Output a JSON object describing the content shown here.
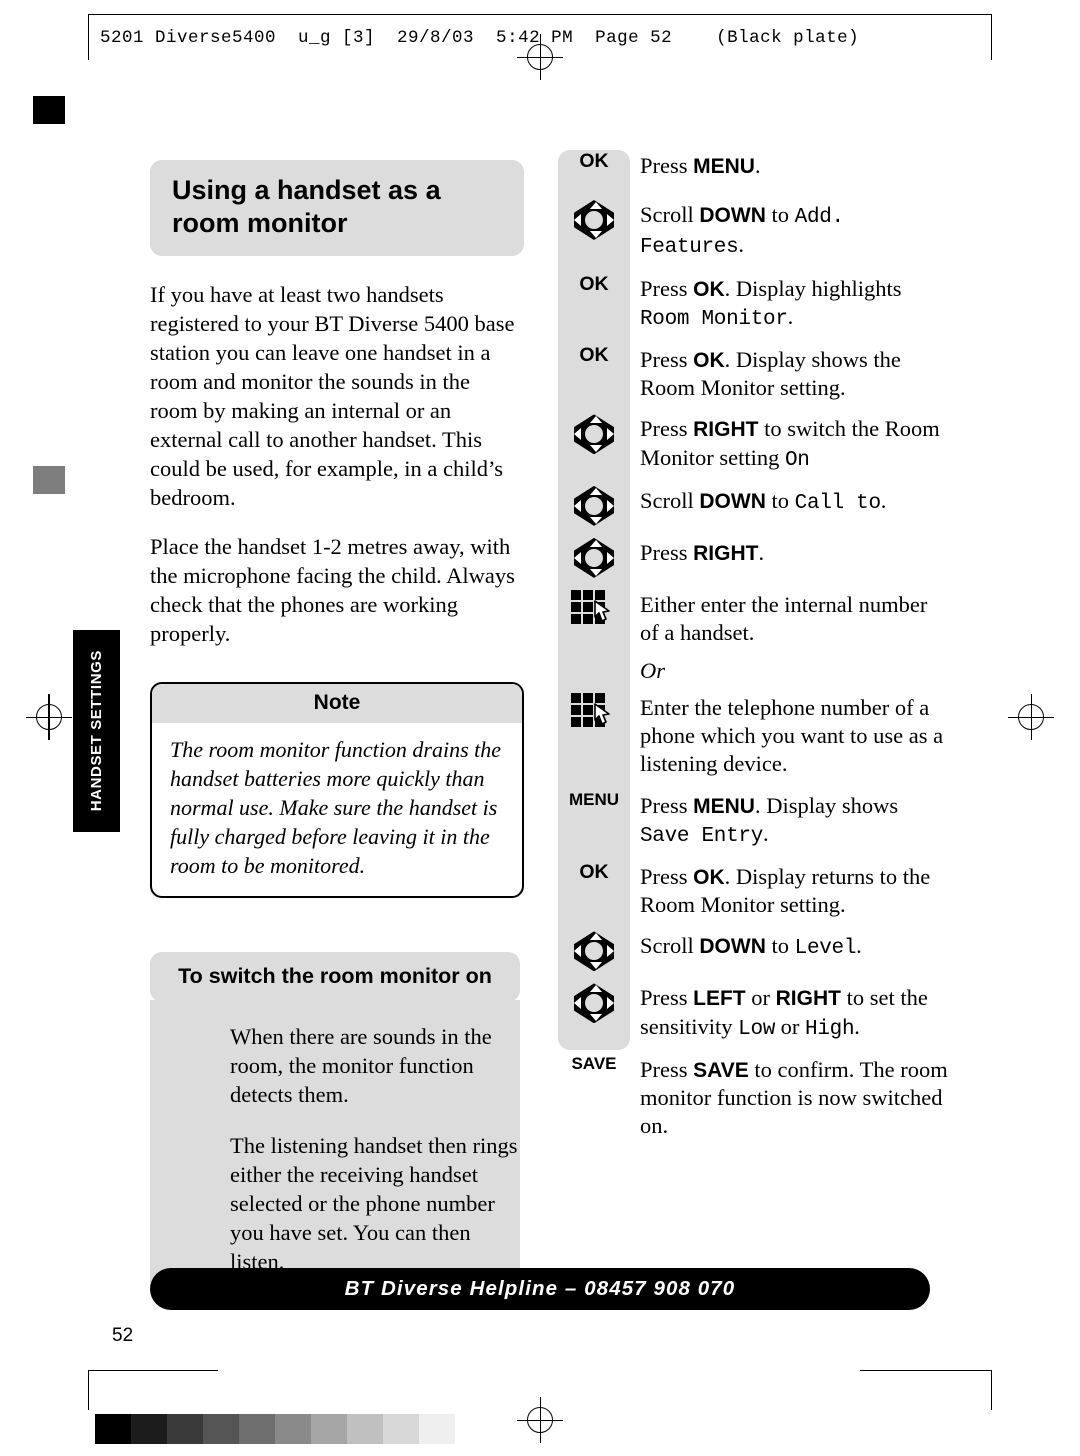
{
  "print_header": "5201 Diverse5400  u_g [3]  29/8/03  5:42 PM  Page 52    (Black plate)",
  "side_tab": "HANDSET SETTINGS",
  "left_column": {
    "title": "Using a handset as a room monitor",
    "paragraphs": [
      "If you have at least two handsets registered to your BT Diverse 5400 base station you can leave one handset in a room and monitor the sounds in the room by making an internal or an external call to another handset. This could be used, for example, in a child’s bedroom.",
      "Place the handset 1-2 metres away, with the microphone facing the child. Always check that the phones are working properly."
    ],
    "note": {
      "heading": "Note",
      "text": "The room monitor function drains the handset batteries more quickly than normal use. Make sure the handset is fully charged before leaving it in the room to be monitored."
    },
    "subsection": {
      "heading": "To switch the room monitor on",
      "paragraphs": [
        "When there are sounds in the room, the monitor function detects them.",
        "The listening handset then rings either the receiving handset selected or the phone number you have set. You can then listen."
      ]
    }
  },
  "steps": [
    {
      "key_type": "label",
      "key": "OK",
      "segments": [
        {
          "t": "Press ",
          "s": "plain"
        },
        {
          "t": "MENU",
          "s": "bold"
        },
        {
          "t": ".",
          "s": "plain"
        }
      ]
    },
    {
      "key_type": "navpad-down",
      "key": "",
      "segments": [
        {
          "t": "Scroll ",
          "s": "plain"
        },
        {
          "t": "DOWN",
          "s": "bold"
        },
        {
          "t": " to ",
          "s": "plain"
        },
        {
          "t": "Add. Features",
          "s": "lcd"
        },
        {
          "t": ".",
          "s": "plain"
        }
      ]
    },
    {
      "key_type": "label",
      "key": "OK",
      "segments": [
        {
          "t": "Press ",
          "s": "plain"
        },
        {
          "t": "OK",
          "s": "bold"
        },
        {
          "t": ". Display highlights ",
          "s": "plain"
        },
        {
          "t": "Room Monitor",
          "s": "lcd"
        },
        {
          "t": ".",
          "s": "plain"
        }
      ]
    },
    {
      "key_type": "label",
      "key": "OK",
      "segments": [
        {
          "t": "Press ",
          "s": "plain"
        },
        {
          "t": "OK",
          "s": "bold"
        },
        {
          "t": ". Display shows the Room Monitor setting.",
          "s": "plain"
        }
      ]
    },
    {
      "key_type": "navpad-right",
      "key": "",
      "segments": [
        {
          "t": "Press ",
          "s": "plain"
        },
        {
          "t": "RIGHT",
          "s": "bold"
        },
        {
          "t": " to switch the Room Monitor setting ",
          "s": "plain"
        },
        {
          "t": "On",
          "s": "lcd"
        }
      ]
    },
    {
      "key_type": "navpad-down",
      "key": "",
      "segments": [
        {
          "t": "Scroll ",
          "s": "plain"
        },
        {
          "t": "DOWN",
          "s": "bold"
        },
        {
          "t": " to ",
          "s": "plain"
        },
        {
          "t": "Call to",
          "s": "lcd"
        },
        {
          "t": ".",
          "s": "plain"
        }
      ]
    },
    {
      "key_type": "navpad-right",
      "key": "",
      "segments": [
        {
          "t": "Press ",
          "s": "plain"
        },
        {
          "t": "RIGHT",
          "s": "bold"
        },
        {
          "t": ".",
          "s": "plain"
        }
      ]
    },
    {
      "key_type": "keypad",
      "key": "",
      "segments": [
        {
          "t": "Either enter the internal number of a handset.",
          "s": "plain"
        }
      ]
    },
    {
      "key_type": "or",
      "key": "",
      "segments": [
        {
          "t": "Or",
          "s": "italic"
        }
      ]
    },
    {
      "key_type": "keypad",
      "key": "",
      "segments": [
        {
          "t": "Enter the telephone number of a phone which you want to use as a listening device.",
          "s": "plain"
        }
      ]
    },
    {
      "key_type": "label",
      "key": "MENU",
      "segments": [
        {
          "t": "Press ",
          "s": "plain"
        },
        {
          "t": "MENU",
          "s": "bold"
        },
        {
          "t": ". Display shows ",
          "s": "plain"
        },
        {
          "t": "Save Entry",
          "s": "lcd"
        },
        {
          "t": ".",
          "s": "plain"
        }
      ]
    },
    {
      "key_type": "label",
      "key": "OK",
      "segments": [
        {
          "t": "Press ",
          "s": "plain"
        },
        {
          "t": "OK",
          "s": "bold"
        },
        {
          "t": ". Display returns to the Room Monitor setting.",
          "s": "plain"
        }
      ]
    },
    {
      "key_type": "navpad-down",
      "key": "",
      "segments": [
        {
          "t": "Scroll ",
          "s": "plain"
        },
        {
          "t": "DOWN",
          "s": "bold"
        },
        {
          "t": " to ",
          "s": "plain"
        },
        {
          "t": "Level",
          "s": "lcd"
        },
        {
          "t": ".",
          "s": "plain"
        }
      ]
    },
    {
      "key_type": "navpad-lr",
      "key": "",
      "segments": [
        {
          "t": "Press ",
          "s": "plain"
        },
        {
          "t": "LEFT",
          "s": "bold"
        },
        {
          "t": " or ",
          "s": "plain"
        },
        {
          "t": "RIGHT",
          "s": "bold"
        },
        {
          "t": " to set the sensitivity ",
          "s": "plain"
        },
        {
          "t": "Low",
          "s": "lcd"
        },
        {
          "t": " or ",
          "s": "plain"
        },
        {
          "t": "High",
          "s": "lcd"
        },
        {
          "t": ".",
          "s": "plain"
        }
      ]
    },
    {
      "key_type": "label",
      "key": "SAVE",
      "segments": [
        {
          "t": "Press ",
          "s": "plain"
        },
        {
          "t": "SAVE",
          "s": "bold"
        },
        {
          "t": " to confirm. The room monitor function is now switched on.",
          "s": "plain"
        }
      ]
    }
  ],
  "footer": {
    "helpline": "BT Diverse Helpline – 08457 908 070",
    "page_number": "52"
  },
  "grayscale": [
    "#000000",
    "#1c1c1c",
    "#3a3a3a",
    "#555555",
    "#6e6e6e",
    "#8a8a8a",
    "#a5a5a5",
    "#c0c0c0",
    "#d8d8d8",
    "#efefef"
  ],
  "colors": {
    "panel": "#dcdcdc",
    "ink": "#000000",
    "paper": "#ffffff"
  }
}
